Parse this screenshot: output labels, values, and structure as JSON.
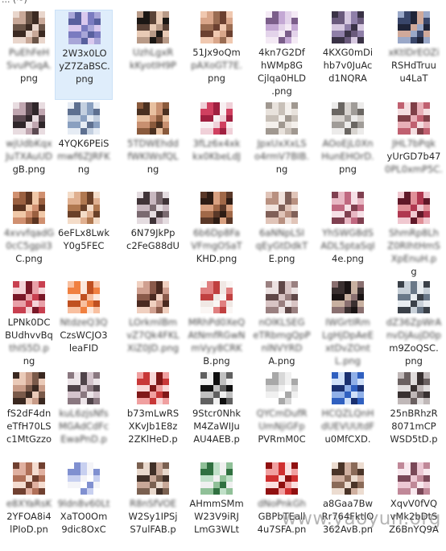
{
  "header": {
    "title": "... (~)"
  },
  "watermark": "www.yaoyun.org",
  "colors": {
    "selection": "#dfedfb",
    "selection_border": "#cbe1f7"
  },
  "files": [
    {
      "lines": [
        "PuEhFeH",
        "SvuPGqA.",
        "png"
      ],
      "blur": [
        0,
        1
      ],
      "thumb": [
        "#3b2a22",
        "#6b5548",
        "#c8a898",
        "#e9d6cc"
      ]
    },
    {
      "lines": [
        "2W3x0LO",
        "yZ7ZaBSC.",
        "png"
      ],
      "blur": [],
      "selected": true,
      "thumb": [
        "#a8a6d8",
        "#7a7bc0",
        "#d9c9ee",
        "#58609e"
      ]
    },
    {
      "lines": [
        "UzhLgxR",
        "kKyotIH9P",
        ""
      ],
      "blur": [
        0,
        1
      ],
      "thumb": [
        "#1b1714",
        "#b89a87",
        "#e8cab5",
        "#5a4236"
      ]
    },
    {
      "lines": [
        "51Jx9oQm",
        "pAXoGT7E.",
        "png"
      ],
      "blur": [
        1
      ],
      "thumb": [
        "#9a6c52",
        "#d9a68a",
        "#f0c8b0",
        "#6b4030"
      ]
    },
    {
      "lines": [
        "4kn7G2Df",
        "hWMp8G",
        "Cjlqa0HLD",
        ".png"
      ],
      "blur": [],
      "thumb": [
        "#e3d3ea",
        "#c4a8d4",
        "#7b5e8a",
        "#f4eaf5"
      ]
    },
    {
      "lines": [
        "4KXG0mDi",
        "hb7v0JuAc",
        "d1NQRA"
      ],
      "blur": [],
      "thumb": [
        "#3a3246",
        "#8f7fa8",
        "#d6c8e0",
        "#6a5a7c"
      ]
    },
    {
      "lines": [
        "xKtlDrEOZi",
        "RSHdTruu",
        "u4LaT"
      ],
      "blur": [
        0
      ],
      "thumb": [
        "#39466a",
        "#9aa8c8",
        "#d0a99a",
        "#1f2438"
      ]
    },
    {
      "lines": [
        "wjUdbKqx",
        "JuTXAuUD",
        "gB.png"
      ],
      "blur": [
        0,
        1
      ],
      "thumb": [
        "#5c4a52",
        "#c0a6b0",
        "#e8dce0",
        "#2f262a"
      ]
    },
    {
      "lines": [
        "4YQK6PEiS",
        "mwf6ZJRFK",
        "ng"
      ],
      "blur": [
        1
      ],
      "thumb": [
        "#8aa0c0",
        "#c4d0e0",
        "#5e7090",
        "#e6ecf4"
      ]
    },
    {
      "lines": [
        "5TDWEhdd",
        "fWKlWsfQL",
        "ng"
      ],
      "blur": [
        0,
        1
      ],
      "thumb": [
        "#8a5a3c",
        "#c89070",
        "#e8c0a0",
        "#4a3020"
      ]
    },
    {
      "lines": [
        "3fLz6x4xk",
        "kx0KbeLdJ",
        ""
      ],
      "blur": [
        0,
        1
      ],
      "thumb": [
        "#d04060",
        "#f0d0d8",
        "#f8f0f2",
        "#a02040"
      ]
    },
    {
      "lines": [
        "JpxUxXxLS",
        "o4rmV7BIB.p",
        "ng"
      ],
      "blur": [
        0,
        1
      ],
      "thumb": [
        "#c8c0b8",
        "#e8e2dc",
        "#a09890",
        "#f4f0ec"
      ]
    },
    {
      "lines": [
        "AOoEjL0Xn",
        "HunEHOrD.",
        "png"
      ],
      "blur": [
        0,
        1
      ],
      "thumb": [
        "#a09c98",
        "#d8d4d0",
        "#6a6662",
        "#ecebea"
      ]
    },
    {
      "lines": [
        "JHL7bPqk",
        "yUrGD7b47",
        "0PL0xmP5C."
      ],
      "blur": [
        0,
        2
      ],
      "thumb": [
        "#c06070",
        "#e8b0b8",
        "#804048",
        "#f4dde0"
      ]
    },
    {
      "lines": [
        "4xvvfqadG",
        "0cC5gpiI3",
        "C.png"
      ],
      "blur": [
        0,
        1
      ],
      "thumb": [
        "#9a6040",
        "#d09070",
        "#f0c8a8",
        "#5c3420"
      ]
    },
    {
      "lines": [
        "6eFLx8Lwk",
        "Y0g5FEC",
        ""
      ],
      "blur": [],
      "thumb": [
        "#b07850",
        "#e0b090",
        "#f4dcc8",
        "#6a4028"
      ]
    },
    {
      "lines": [
        "6N79JkPp",
        "c2FeG88dU",
        ""
      ],
      "blur": [],
      "thumb": [
        "#7a6a70",
        "#c8b8c0",
        "#403438",
        "#e4dce0"
      ]
    },
    {
      "lines": [
        "6b6Dp8Fa",
        "VFmgOSaT",
        "KHD.png"
      ],
      "blur": [
        0,
        1
      ],
      "thumb": [
        "#5a3828",
        "#a06848",
        "#d8a080",
        "#2e1c14"
      ]
    },
    {
      "lines": [
        "6aNNpLSI",
        "qEyGtDdkT",
        "E.png"
      ],
      "blur": [
        0,
        1
      ],
      "thumb": [
        "#b89080",
        "#e0c4b8",
        "#806058",
        "#f0e2dc"
      ]
    },
    {
      "lines": [
        "YhSWG8dS",
        "ADL5ptaSqI",
        "4e.png"
      ],
      "blur": [
        0,
        1
      ],
      "thumb": [
        "#c06880",
        "#e8b8c4",
        "#804050",
        "#f6e0e6"
      ]
    },
    {
      "lines": [
        "ShmRp8Lh",
        "Z0RIhtHmS",
        "XpEnuH.p",
        "g"
      ],
      "blur": [
        0,
        1,
        2
      ],
      "thumb": [
        "#b03850",
        "#e09098",
        "#601828",
        "#f0c8d0"
      ]
    },
    {
      "lines": [
        "LPNk0DC",
        "BUdhvvBq",
        "thIS5D.p",
        "ng"
      ],
      "blur": [
        2
      ],
      "thumb": [
        "#c84050",
        "#e8a0a8",
        "#7a1828",
        "#f4d4d8"
      ]
    },
    {
      "lines": [
        "NtdzeQ3Q",
        "CzsWCJO3",
        "leaFID"
      ],
      "blur": [
        0
      ],
      "thumb": [
        "#f08040",
        "#f8c0a0",
        "#c05020",
        "#fce8dc"
      ]
    },
    {
      "lines": [
        "LOrkmlBm",
        "vZ7Qk4FKL",
        "XiZ0JD.png"
      ],
      "blur": [
        0,
        1,
        2
      ],
      "thumb": [
        "#8a5a4a",
        "#d0a090",
        "#f0d0c0",
        "#4a2a20"
      ]
    },
    {
      "lines": [
        "MRhPd0XeQ",
        "AtNmfRGwN",
        "mVyy8CRK",
        "B.png"
      ],
      "blur": [
        0,
        1,
        2
      ],
      "thumb": [
        "#f0e8e4",
        "#c04040",
        "#e08080",
        "#faf6f4"
      ]
    },
    {
      "lines": [
        "nOlKLSEG",
        "eTRbmgQpP",
        "nlNVYRD",
        "A.png"
      ],
      "blur": [
        0,
        1,
        2
      ],
      "thumb": [
        "#9a8080",
        "#d8c4c4",
        "#604848",
        "#ece2e2"
      ]
    },
    {
      "lines": [
        "IWGrtIRm",
        "LgHjDpAeE",
        "xtDvZOnt",
        "L.png"
      ],
      "blur": [
        0,
        1,
        2,
        3
      ],
      "thumb": [
        "#3a3030",
        "#8a7070",
        "#c8b0a0",
        "#1a1414"
      ]
    },
    {
      "lines": [
        "dZ36ZpWrA",
        "nvDjAujD0p",
        "m9ZoQSC.",
        "png"
      ],
      "blur": [
        0,
        1
      ],
      "thumb": [
        "#6a7888",
        "#c8d0d8",
        "#3a4048",
        "#e8ecf0"
      ]
    },
    {
      "lines": [
        "fS2dF4dn",
        "eTfH70LS",
        "c1MtGzzo"
      ],
      "blur": [],
      "thumb": [
        "#7a5a4a",
        "#c89c88",
        "#eacab8",
        "#3a2820"
      ]
    },
    {
      "lines": [
        "kuL6zjsNfs",
        "MGAdCdFc",
        "EwaPnD.p"
      ],
      "blur": [
        0,
        1,
        2
      ],
      "thumb": [
        "#8a7880",
        "#d4c4cc",
        "#50444a",
        "#ece4e8"
      ]
    },
    {
      "lines": [
        "b73mLwRS",
        "XKvJb1E8z",
        "2ZKlHeD.p"
      ],
      "blur": [],
      "thumb": [
        "#c83838",
        "#f0a0a0",
        "#801818",
        "#f8d8d8"
      ]
    },
    {
      "lines": [
        "9Stcr0Nhk",
        "M4ZaWIJu",
        "AU4AEB.p"
      ],
      "blur": [],
      "thumb": [
        "#101010",
        "#f0f0f0",
        "#606060",
        "#c0c0c0"
      ]
    },
    {
      "lines": [
        "QYCmDufR",
        "UmNjiGFp",
        "PVRmM0C"
      ],
      "blur": [
        0,
        1
      ],
      "thumb": [
        "#f0f0f0",
        "#d8d8d8",
        "#a8a8a8",
        "#ffffff"
      ]
    },
    {
      "lines": [
        "HCQZLQnHCQZ",
        "dUEVUUtdFA",
        "u0MfCXD."
      ],
      "blur": [
        0,
        1
      ],
      "thumb": [
        "#3060c0",
        "#90b0e8",
        "#1a3070",
        "#d0e0f8"
      ]
    },
    {
      "lines": [
        "25nBRhzR",
        "8071mCP",
        "WSD5tD.p"
      ],
      "blur": [],
      "thumb": [
        "#6a6060",
        "#c0b8b8",
        "#383030",
        "#e0dcdc"
      ]
    },
    {
      "lines": [
        "e8XYaRsK",
        "2YFOA8i4",
        "lPIoD.pn"
      ],
      "blur": [
        0
      ],
      "thumb": [
        "#b07058",
        "#e0b0a0",
        "#704030",
        "#f4dcd0"
      ]
    },
    {
      "lines": [
        "9ldn8v60Lt",
        "XaTO0Om",
        "9dic8OxC"
      ],
      "blur": [
        0
      ],
      "thumb": [
        "#f4f4f8",
        "#c8d0f0",
        "#8090d0",
        "#ffffff"
      ]
    },
    {
      "lines": [
        "R8nSfVOE",
        "W2Sy1IPSj",
        "S7ulFAB.p"
      ],
      "blur": [
        0
      ],
      "thumb": [
        "#7a6050",
        "#c8a898",
        "#403028",
        "#e8d8cc"
      ]
    },
    {
      "lines": [
        "AHmmSMmb",
        "W23V9iRJ",
        "LmG3WLt"
      ],
      "blur": [],
      "thumb": [
        "#307040",
        "#90c098",
        "#f0f0f0",
        "#c0e0c8"
      ]
    },
    {
      "lines": [
        "dNoPnkGh",
        "GBPbTEall",
        "4u7SFA.pn"
      ],
      "blur": [
        0
      ],
      "thumb": [
        "#d03030",
        "#f0a0a0",
        "#901010",
        "#fae0e0"
      ]
    },
    {
      "lines": [
        "a8Gaa7Bw",
        "Rr764FktlO",
        "362AvB.pn"
      ],
      "blur": [],
      "thumb": [
        "#8a6a58",
        "#d0b0a0",
        "#4a3428",
        "#ecdcd0"
      ]
    },
    {
      "lines": [
        "XqvV0fVQ",
        "vMk2bDtS",
        "Z6BnYQ9A"
      ],
      "blur": [],
      "thumb": [
        "#c08898",
        "#ecc8d4",
        "#7a4858",
        "#f8e8ee"
      ]
    }
  ]
}
